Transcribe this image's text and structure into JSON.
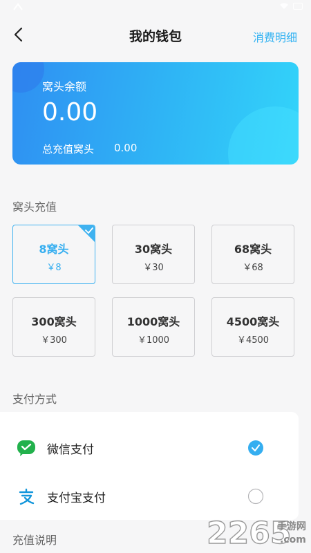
{
  "header": {
    "title": "我的钱包",
    "details_label": "消费明细"
  },
  "balance": {
    "label": "窝头余额",
    "value": "0.00",
    "total_label": "总充值窝头",
    "total_value": "0.00"
  },
  "recharge": {
    "title": "窝头充值",
    "options": [
      {
        "label": "8窝头",
        "price": "￥8",
        "selected": true
      },
      {
        "label": "30窝头",
        "price": "￥30",
        "selected": false
      },
      {
        "label": "68窝头",
        "price": "￥68",
        "selected": false
      },
      {
        "label": "300窝头",
        "price": "￥300",
        "selected": false
      },
      {
        "label": "1000窝头",
        "price": "￥1000",
        "selected": false
      },
      {
        "label": "4500窝头",
        "price": "￥4500",
        "selected": false
      }
    ]
  },
  "payment": {
    "title": "支付方式",
    "methods": [
      {
        "label": "微信支付",
        "icon": "wechat-pay-icon",
        "selected": true
      },
      {
        "label": "支付宝支付",
        "icon": "alipay-icon",
        "selected": false
      }
    ]
  },
  "notes": {
    "title": "充值说明"
  },
  "watermark": {
    "number": "2265",
    "text": "手游网",
    "domain": ".com"
  },
  "colors": {
    "accent": "#35aef0",
    "card_start": "#2f8ff2",
    "card_end": "#33d4fa",
    "wechat_green": "#22b14c",
    "alipay_blue": "#1296db"
  }
}
